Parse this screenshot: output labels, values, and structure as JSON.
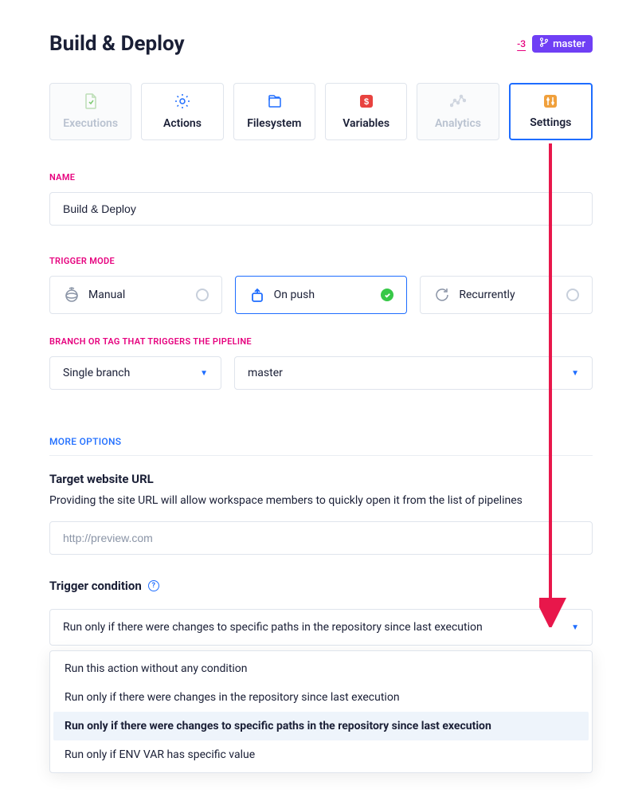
{
  "header": {
    "title": "Build & Deploy",
    "diff": "-3",
    "branch": "master"
  },
  "tabs": {
    "executions": "Executions",
    "actions": "Actions",
    "filesystem": "Filesystem",
    "variables": "Variables",
    "analytics": "Analytics",
    "settings": "Settings"
  },
  "labels": {
    "name": "NAME",
    "trigger_mode": "TRIGGER MODE",
    "branch_trigger": "BRANCH OR TAG THAT TRIGGERS THE PIPELINE",
    "more_options": "MORE OPTIONS",
    "target_url_title": "Target website URL",
    "target_url_desc": "Providing the site URL will allow workspace members to quickly open it from the list of pipelines",
    "trigger_condition": "Trigger condition"
  },
  "name_value": "Build & Deploy",
  "trigger_modes": {
    "manual": "Manual",
    "on_push": "On push",
    "recurrently": "Recurrently"
  },
  "branch": {
    "type": "Single branch",
    "value": "master"
  },
  "url_placeholder": "http://preview.com",
  "condition": {
    "selected": "Run only if there were changes to specific paths in the repository since last execution",
    "options": [
      "Run this action without any condition",
      "Run only if there were changes in the repository since last execution",
      "Run only if there were changes to specific paths in the repository since last execution",
      "Run only if ENV VAR has specific value"
    ]
  }
}
